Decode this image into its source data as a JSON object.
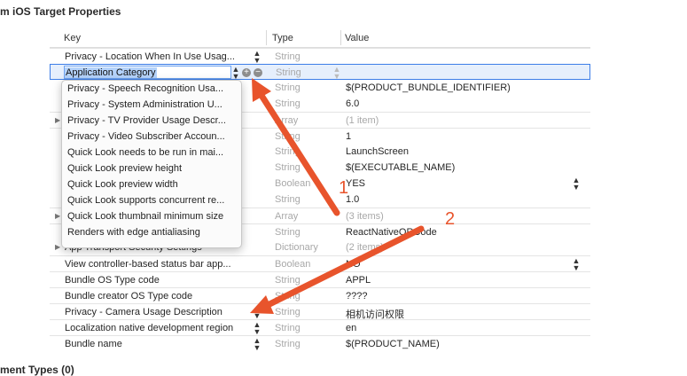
{
  "section": {
    "title": "m iOS Target Properties",
    "bottom_title": "ment Types (0)"
  },
  "columns": {
    "key": "Key",
    "type": "Type",
    "value": "Value"
  },
  "editing": {
    "value": "Application Category",
    "type": "String"
  },
  "rows": [
    {
      "key": "Privacy - Location When In Use Usag...",
      "type": "String",
      "value": ""
    },
    {
      "key": "",
      "type": "String",
      "value": "$(PRODUCT_BUNDLE_IDENTIFIER)"
    },
    {
      "key": "",
      "type": "String",
      "value": "6.0"
    },
    {
      "key": "",
      "type": "Array",
      "value": "(1 item)"
    },
    {
      "key": "",
      "type": "String",
      "value": "1"
    },
    {
      "key": "",
      "type": "String",
      "value": "LaunchScreen"
    },
    {
      "key": "",
      "type": "String",
      "value": "$(EXECUTABLE_NAME)"
    },
    {
      "key": "",
      "type": "Boolean",
      "value": "YES"
    },
    {
      "key": "",
      "type": "String",
      "value": "1.0"
    },
    {
      "key": "",
      "type": "Array",
      "value": "(3 items)"
    },
    {
      "key": "",
      "type": "String",
      "value": "ReactNativeQRCode"
    },
    {
      "key": "App Transport Security Settings",
      "type": "Dictionary",
      "value": "(2 items)"
    },
    {
      "key": "View controller-based status bar app...",
      "type": "Boolean",
      "value": "NO"
    },
    {
      "key": "Bundle OS Type code",
      "type": "String",
      "value": "APPL"
    },
    {
      "key": "Bundle creator OS Type code",
      "type": "String",
      "value": "????"
    },
    {
      "key": "Privacy - Camera Usage Description",
      "type": "String",
      "value": "相机访问权限"
    },
    {
      "key": "Localization native development region",
      "type": "String",
      "value": "en"
    },
    {
      "key": "Bundle name",
      "type": "String",
      "value": "$(PRODUCT_NAME)"
    }
  ],
  "popup_items": [
    "Privacy - Speech Recognition Usa...",
    "Privacy - System Administration U...",
    "Privacy - TV Provider Usage Descr...",
    "Privacy - Video Subscriber Accoun...",
    "Quick Look needs to be run in mai...",
    "Quick Look preview height",
    "Quick Look preview width",
    "Quick Look supports concurrent re...",
    "Quick Look thumbnail minimum size",
    "Renders with edge antialiasing"
  ],
  "annotations": {
    "label_1": "1",
    "label_2": "2",
    "arrow_color": "#e8542c"
  },
  "icons": {
    "stepper": "up-down-stepper-icon",
    "add": "plus-circle-icon",
    "remove": "minus-circle-icon",
    "disclosure": "disclosure-triangle-icon"
  }
}
